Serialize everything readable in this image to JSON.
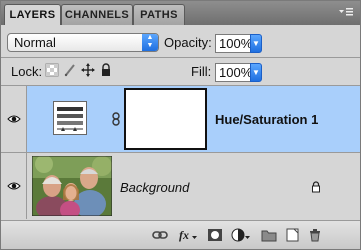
{
  "tabs": [
    {
      "label": "LAYERS",
      "active": true
    },
    {
      "label": "CHANNELS",
      "active": false
    },
    {
      "label": "PATHS",
      "active": false
    }
  ],
  "panel_menu_icon": "panel-menu-icon",
  "blend_mode": {
    "value": "Normal"
  },
  "opacity": {
    "label": "Opacity:",
    "value": "100%"
  },
  "lock": {
    "label": "Lock:",
    "icons": [
      "lock-transparent-pixels-icon",
      "lock-image-pixels-icon",
      "lock-position-icon",
      "lock-all-icon"
    ]
  },
  "fill": {
    "label": "Fill:",
    "value": "100%"
  },
  "layers": [
    {
      "name": "Hue/Saturation 1",
      "type": "adjustment",
      "selected": true,
      "visible": true,
      "has_mask": true
    },
    {
      "name": "Background",
      "type": "image",
      "selected": false,
      "visible": true,
      "locked": true
    }
  ],
  "bottom_icons": [
    "link-layers-icon",
    "fx-icon",
    "add-mask-icon",
    "new-adjustment-layer-icon",
    "new-group-icon",
    "new-layer-icon",
    "delete-layer-icon"
  ],
  "colors": {
    "selected_row": "#a9cffb",
    "panel_bg": "#d6d6d6",
    "accent": "#1f6fe0"
  }
}
